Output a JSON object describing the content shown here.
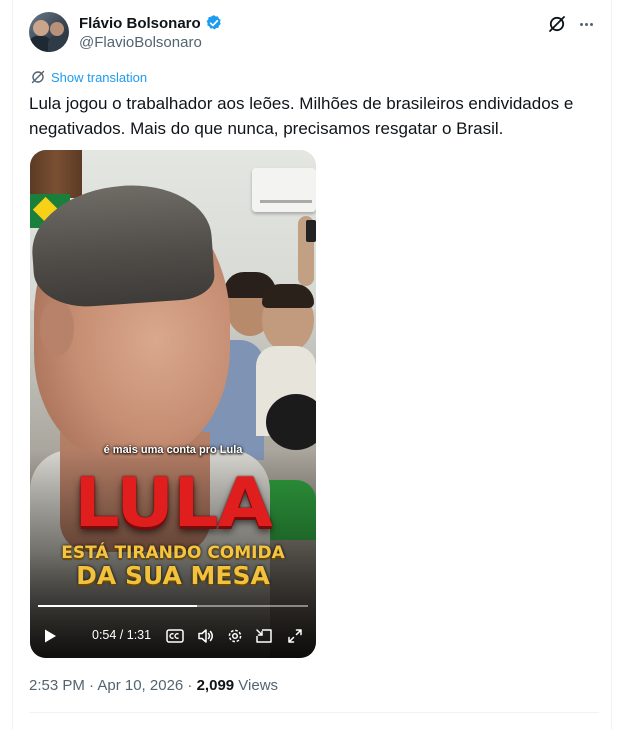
{
  "author": {
    "name": "Flávio Bolsonaro",
    "handle": "@FlavioBolsonaro",
    "verified": true
  },
  "translate_label": "Show translation",
  "tweet_text": "Lula jogou o trabalhador aos leões. Milhões de brasileiros endividados e negativados. Mais do que nunca, precisamos resgatar o Brasil.",
  "video": {
    "caption": "é mais uma conta pro Lula",
    "headline": "LULA",
    "subline1": "ESTÁ TIRANDO COMIDA",
    "subline2": "DA SUA MESA",
    "timecode": "0:54 / 1:31",
    "progress": 0.59
  },
  "meta": {
    "time": "2:53 PM · Apr 10, 2026 · ",
    "views_count": "2,099",
    "views_label": " Views"
  },
  "colors": {
    "link": "#1d9bf0",
    "verified": "#1d9bf0",
    "secondary_text": "#536471",
    "headline_red": "#e01e1e",
    "headline_gold": "#f5c542"
  }
}
